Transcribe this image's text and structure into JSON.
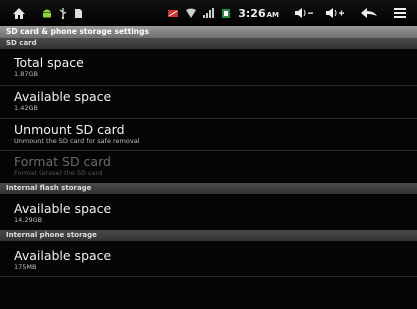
{
  "status_bar": {
    "time": "3:26",
    "ampm": "AM",
    "volume_down": "◀)−",
    "volume_up": "◀)+"
  },
  "screen_title": "SD card & phone storage settings",
  "sections": [
    {
      "header": "SD card",
      "items": [
        {
          "title": "Total space",
          "summary": "1.87GB"
        },
        {
          "title": "Available space",
          "summary": "1.42GB"
        },
        {
          "title": "Unmount SD card",
          "summary": "Unmount the SD card for safe removal"
        },
        {
          "title": "Format SD card",
          "summary": "Format (erase) the SD card",
          "enabled": false
        }
      ]
    },
    {
      "header": "Internal flash storage",
      "items": [
        {
          "title": "Available space",
          "summary": "14.29GB"
        }
      ]
    },
    {
      "header": "Internal phone storage",
      "items": [
        {
          "title": "Available space",
          "summary": "175MB"
        }
      ]
    }
  ]
}
